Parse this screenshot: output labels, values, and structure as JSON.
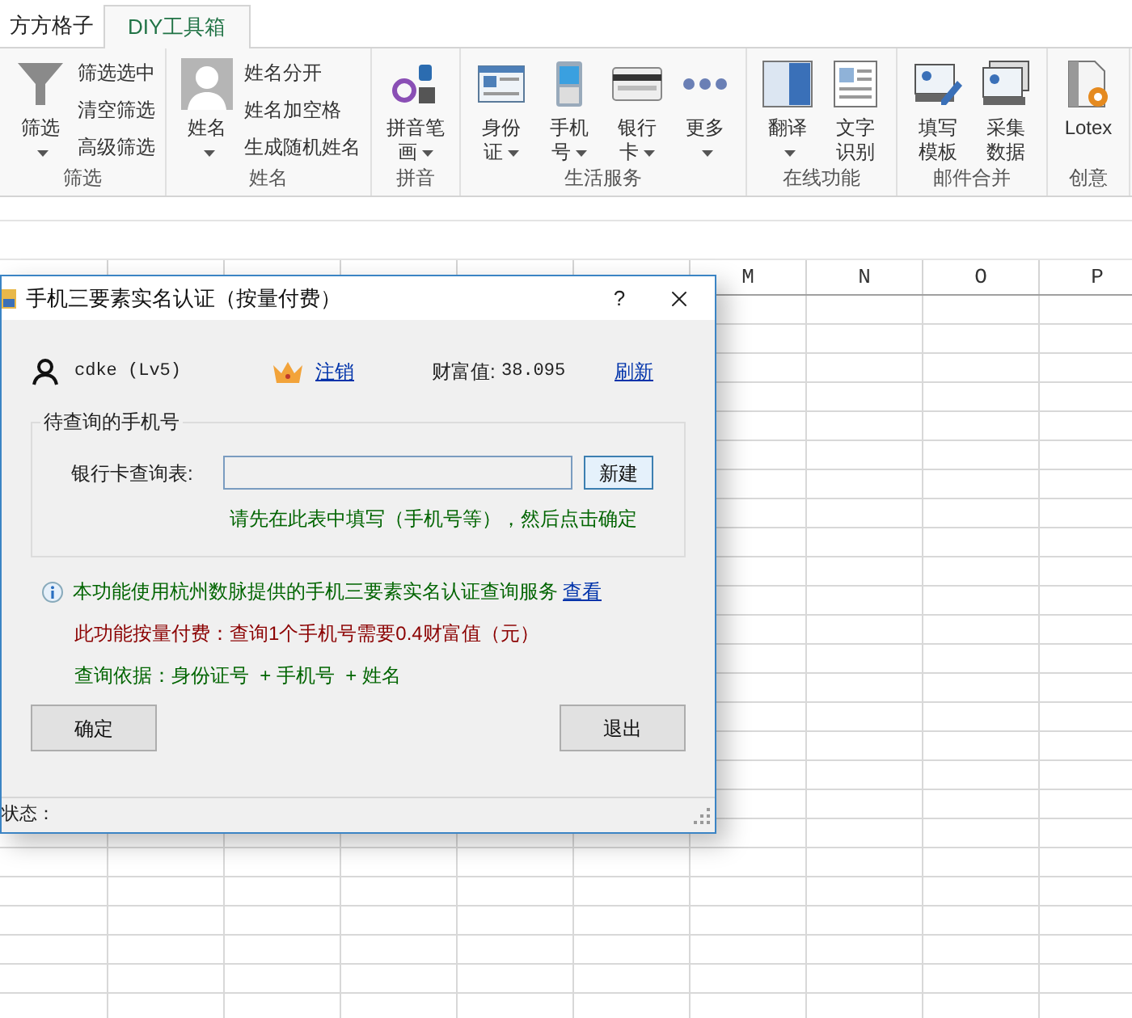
{
  "tabs": [
    {
      "label": "方方格子",
      "selected": false
    },
    {
      "label": "DIY工具箱",
      "selected": true
    }
  ],
  "ribbon": {
    "groups": [
      {
        "label": "筛选",
        "buttons": [
          {
            "kind": "funnel",
            "lines": [
              "筛选"
            ],
            "dropdown": true
          }
        ],
        "small_items": [
          "筛选选中",
          "清空筛选",
          "高级筛选"
        ]
      },
      {
        "label": "姓名",
        "buttons": [
          {
            "kind": "avatar",
            "lines": [
              "姓名"
            ],
            "dropdown": true
          }
        ],
        "small_items": [
          "姓名分开",
          "姓名加空格",
          "生成随机姓名"
        ]
      },
      {
        "label": "拼音",
        "buttons": [
          {
            "kind": "pinyin",
            "lines": [
              "拼音笔",
              "画"
            ],
            "dropdown": true
          }
        ]
      },
      {
        "label": "生活服务",
        "buttons": [
          {
            "kind": "idcard",
            "lines": [
              "身份",
              "证"
            ],
            "dropdown": true
          },
          {
            "kind": "phone",
            "lines": [
              "手机",
              "号"
            ],
            "dropdown": true
          },
          {
            "kind": "bankcard",
            "lines": [
              "银行",
              "卡"
            ],
            "dropdown": true
          },
          {
            "kind": "more",
            "lines": [
              "更多"
            ],
            "dropdown": true
          }
        ]
      },
      {
        "label": "在线功能",
        "buttons": [
          {
            "kind": "translate",
            "lines": [
              "翻译"
            ],
            "dropdown": true
          },
          {
            "kind": "ocr",
            "lines": [
              "文字",
              "识别"
            ],
            "dropdown": false
          }
        ]
      },
      {
        "label": "邮件合并",
        "buttons": [
          {
            "kind": "fill",
            "lines": [
              "填写",
              "模板"
            ],
            "dropdown": false
          },
          {
            "kind": "collect",
            "lines": [
              "采集",
              "数据"
            ],
            "dropdown": false
          }
        ]
      },
      {
        "label": "创意",
        "buttons": [
          {
            "kind": "lotex",
            "lines": [
              "Lotex"
            ],
            "dropdown": false
          }
        ]
      }
    ]
  },
  "sheet": {
    "columns": [
      "M",
      "N",
      "O",
      "P"
    ]
  },
  "dialog": {
    "title": "手机三要素实名认证（按量付费）",
    "help": "?",
    "user": {
      "name": "cdke (Lv5)",
      "logout": "注销",
      "wealth_label": "财富值:",
      "wealth_value": "38.095",
      "refresh": "刷新"
    },
    "group": {
      "legend": "待查询的手机号",
      "field_label": "银行卡查询表:",
      "new_button": "新建",
      "hint": "请先在此表中填写（手机号等），然后点击确定"
    },
    "info": {
      "text": "本功能使用杭州数脉提供的手机三要素实名认证查询服务",
      "link": "查看"
    },
    "price": "此功能按量付费：查询1个手机号需要0.4财富值（元）",
    "basis": "查询依据：身份证号  + 手机号  + 姓名",
    "buttons": [
      "确定",
      "退出"
    ],
    "status": "状态："
  }
}
